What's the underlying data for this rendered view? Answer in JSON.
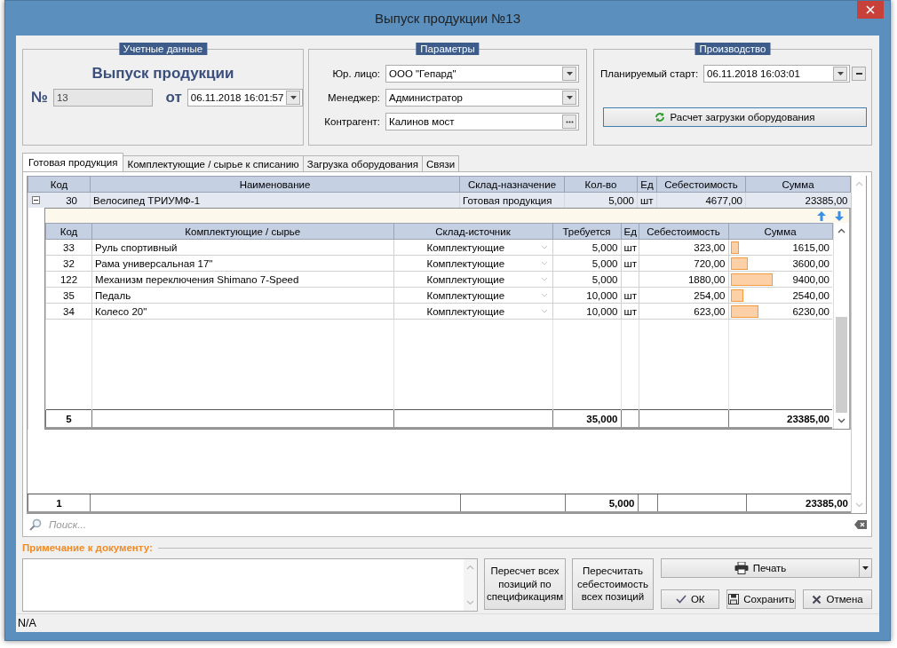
{
  "window": {
    "title": "Выпуск продукции №13"
  },
  "accounting": {
    "legend": "Учетные данные",
    "heading": "Выпуск продукции",
    "number_label": "№",
    "number": "13",
    "date_label": "от",
    "date": "06.11.2018 16:01:57"
  },
  "parameters": {
    "legend": "Параметры",
    "fields": [
      {
        "label": "Юр. лицо:",
        "value": "ООО \"Гепард\"",
        "kind": "dropdown"
      },
      {
        "label": "Менеджер:",
        "value": "Администратор",
        "kind": "dropdown"
      },
      {
        "label": "Контрагент:",
        "value": "Калинов мост",
        "kind": "lookup"
      }
    ]
  },
  "production": {
    "legend": "Производство",
    "start_label": "Планируемый старт:",
    "start_value": "06.11.2018 16:03:01",
    "calc_button": "Расчет загрузки оборудования"
  },
  "tabs": [
    {
      "label": "Готовая продукция",
      "selected": true
    },
    {
      "label": "Комплектующие / сырье к списанию",
      "selected": false
    },
    {
      "label": "Загрузка оборудования",
      "selected": false
    },
    {
      "label": "Связи",
      "selected": false
    }
  ],
  "table": {
    "columns": [
      "Код",
      "Наименование",
      "Склад-назначение",
      "Кол-во",
      "Ед",
      "Себестоимость",
      "Сумма"
    ],
    "rows": [
      {
        "code": "30",
        "name": "Велосипед ТРИУМФ-1",
        "warehouse": "Готовая продукция",
        "qty": "5,000",
        "unit": "шт",
        "cost": "4677,00",
        "sum": "23385,00",
        "expanded": true,
        "detail": {
          "columns": [
            "Код",
            "Комплектующие / сырье",
            "Склад-источник",
            "Требуется",
            "Ед",
            "Себестоимость",
            "Сумма"
          ],
          "rows": [
            {
              "code": "33",
              "name": "Руль спортивный",
              "warehouse": "Комплектующие",
              "qty": "5,000",
              "unit": "шт",
              "cost": "323,00",
              "sum": "1615,00",
              "level": 0.069
            },
            {
              "code": "32",
              "name": "Рама универсальная 17\"",
              "warehouse": "Комплектующие",
              "qty": "5,000",
              "unit": "шт",
              "cost": "720,00",
              "sum": "3600,00",
              "level": 0.154
            },
            {
              "code": "122",
              "name": "Механизм переключения Shimano 7-Speed",
              "warehouse": "Комплектующие",
              "qty": "5,000",
              "cost": "1880,00",
              "sum": "9400,00",
              "level": 0.402
            },
            {
              "code": "35",
              "name": "Педаль",
              "warehouse": "Комплектующие",
              "qty": "10,000",
              "unit": "шт",
              "cost": "254,00",
              "sum": "2540,00",
              "level": 0.109
            },
            {
              "code": "34",
              "name": "Колесо 20\"",
              "warehouse": "Комплектующие",
              "qty": "10,000",
              "unit": "шт",
              "cost": "623,00",
              "sum": "6230,00",
              "level": 0.266
            }
          ],
          "totals": {
            "count": "5",
            "qty": "35,000",
            "sum": "23385,00"
          }
        }
      }
    ],
    "totals": {
      "count": "1",
      "qty": "5,000",
      "sum": "23385,00"
    }
  },
  "search": {
    "placeholder": "Поиск..."
  },
  "note": {
    "label": "Примечание к документу:"
  },
  "buttons": {
    "recalc_spec": "Пересчет всех позиций по спецификациям",
    "recalc_cost": "Пересчитать себестоимость всех позиций",
    "print": "Печать",
    "ok": "ОК",
    "save": "Сохранить",
    "cancel": "Отмена"
  },
  "status_bar": "N/A"
}
